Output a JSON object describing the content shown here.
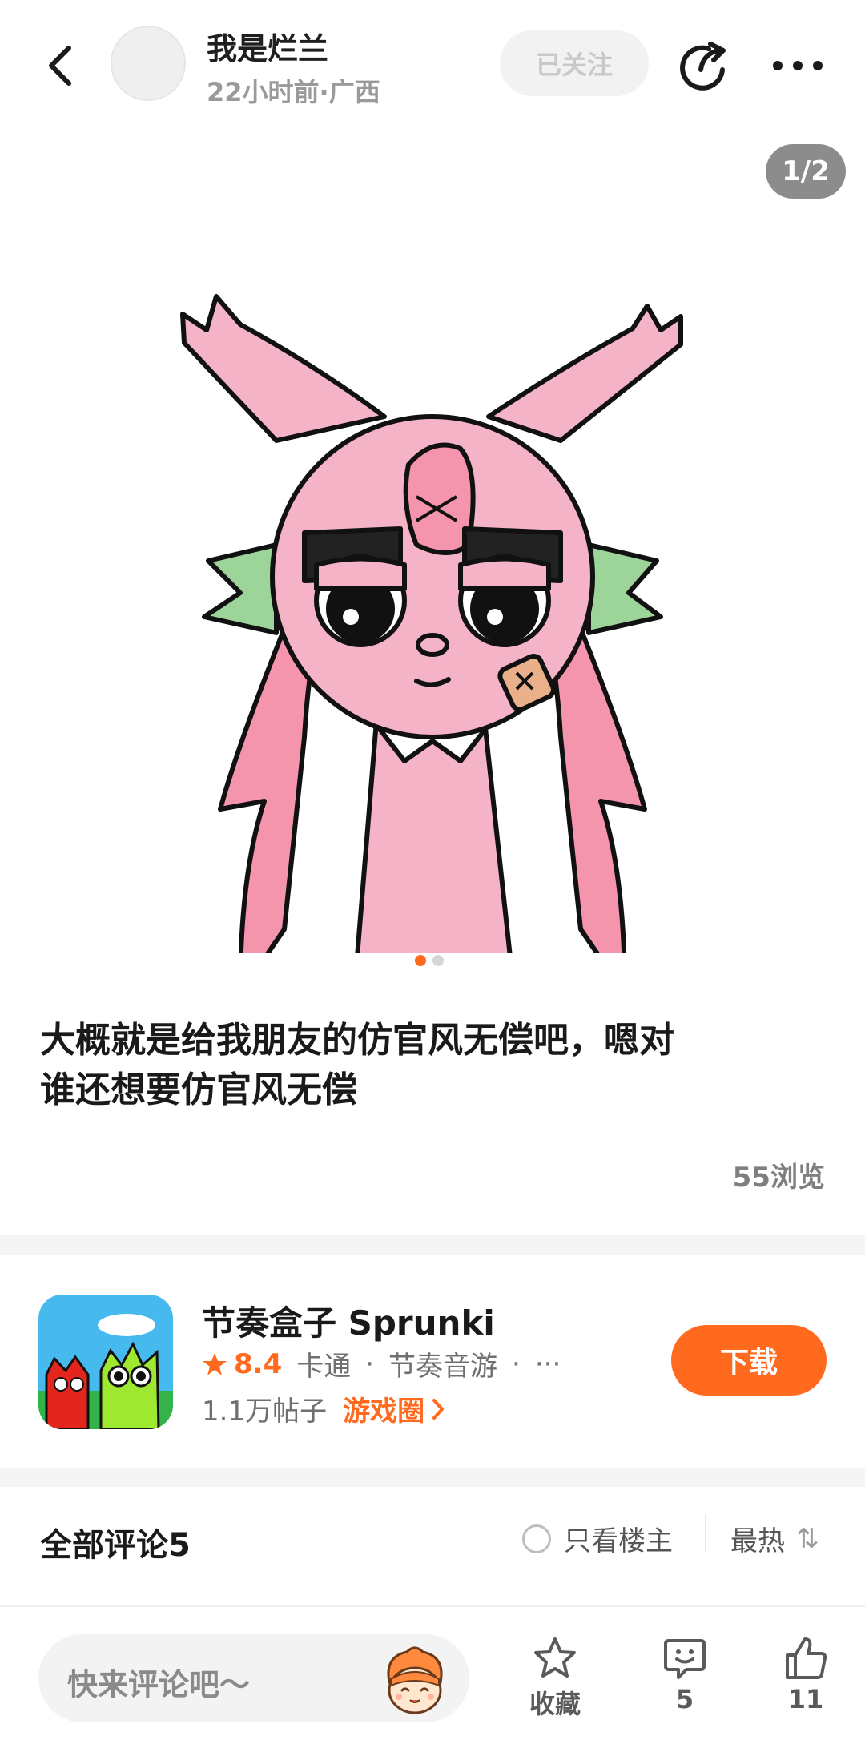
{
  "header": {
    "author_name": "我是烂兰",
    "author_meta": "22小时前·广西",
    "follow_label": "已关注"
  },
  "image": {
    "counter": "1/2",
    "total": 2,
    "current": 1
  },
  "post": {
    "text_line1": "大概就是给我朋友的仿官风无偿吧，嗯对",
    "text_line2": "谁还想要仿官风无偿",
    "views": "55浏览"
  },
  "game": {
    "title": "节奏盒子 Sprunki",
    "rating": "8.4",
    "tags": [
      "卡通",
      "·",
      "节奏音游",
      "·",
      "···"
    ],
    "posts_count": "1.1万帖子",
    "circle_link": "游戏圈",
    "download_label": "下载"
  },
  "comments": {
    "title": "全部评论5",
    "only_op_label": "只看楼主",
    "sort_label": "最热",
    "sort_icon": "⇅"
  },
  "bottom_bar": {
    "placeholder": "快来评论吧～",
    "favorite_label": "收藏",
    "comment_count": "5",
    "like_count": "11"
  },
  "colors": {
    "accent": "#ff6a1f",
    "character_pink": "#f4b3c6",
    "hair_pink": "#f594ad",
    "leaf_green": "#9dd49a"
  }
}
